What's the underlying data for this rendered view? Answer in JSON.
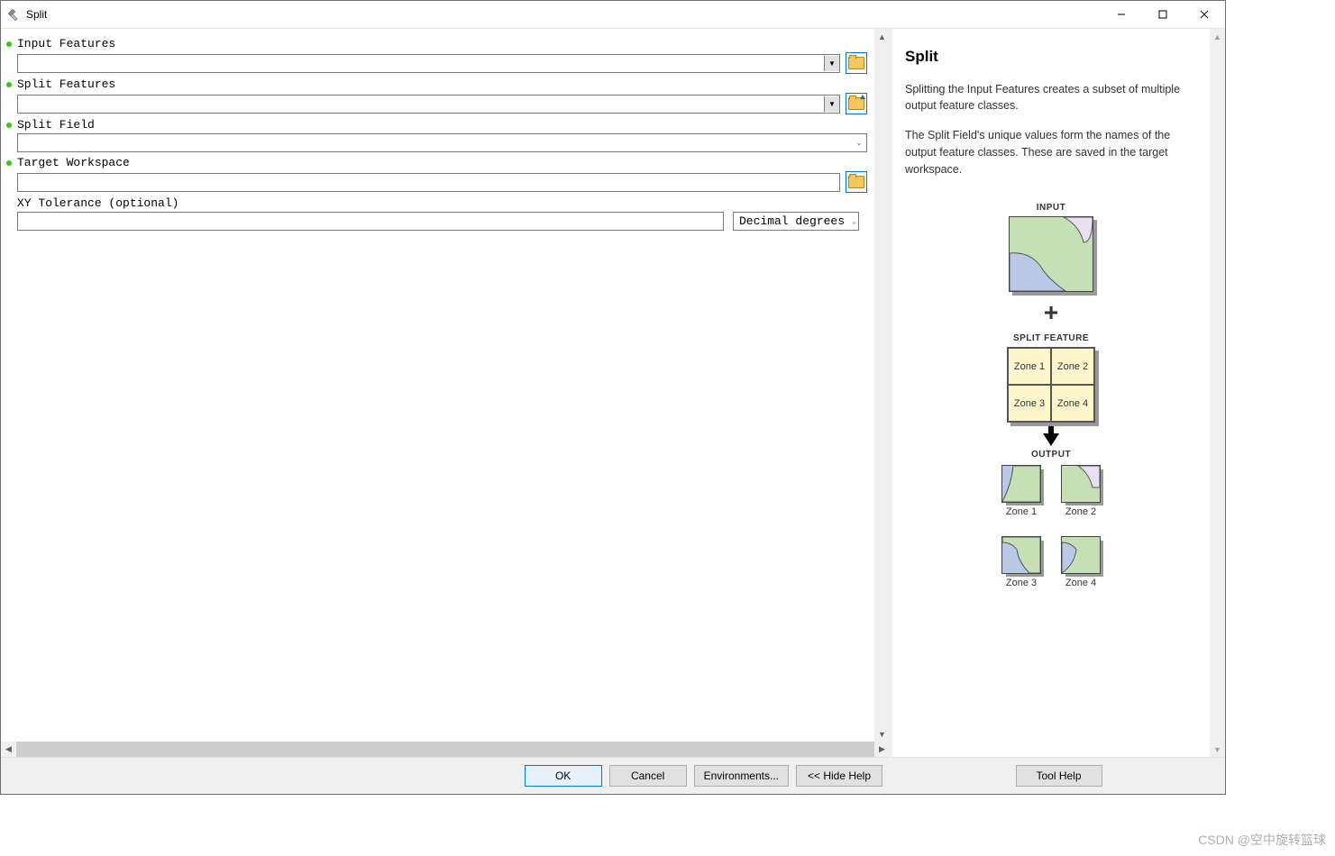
{
  "window": {
    "title": "Split"
  },
  "form": {
    "fields": {
      "input_features": {
        "label": "Input Features"
      },
      "split_features": {
        "label": "Split Features"
      },
      "split_field": {
        "label": "Split Field"
      },
      "target_workspace": {
        "label": "Target Workspace"
      },
      "xy_tolerance": {
        "label": "XY Tolerance (optional)",
        "unit": "Decimal degrees"
      }
    }
  },
  "buttons": {
    "ok": "OK",
    "cancel": "Cancel",
    "environments": "Environments...",
    "hide_help": "<< Hide Help",
    "tool_help": "Tool Help"
  },
  "help": {
    "title": "Split",
    "p1": "Splitting the Input Features creates a subset of multiple output feature classes.",
    "p2": "The Split Field's unique values form the names of the output feature classes. These are saved in the target workspace.",
    "diagram": {
      "input_label": "INPUT",
      "split_label": "SPLIT FEATURE",
      "zones": [
        "Zone 1",
        "Zone 2",
        "Zone 3",
        "Zone 4"
      ],
      "output_label": "OUTPUT",
      "outputs": [
        "Zone 1",
        "Zone 2",
        "Zone 3",
        "Zone 4"
      ]
    }
  },
  "watermark": "CSDN @空中旋转篮球"
}
